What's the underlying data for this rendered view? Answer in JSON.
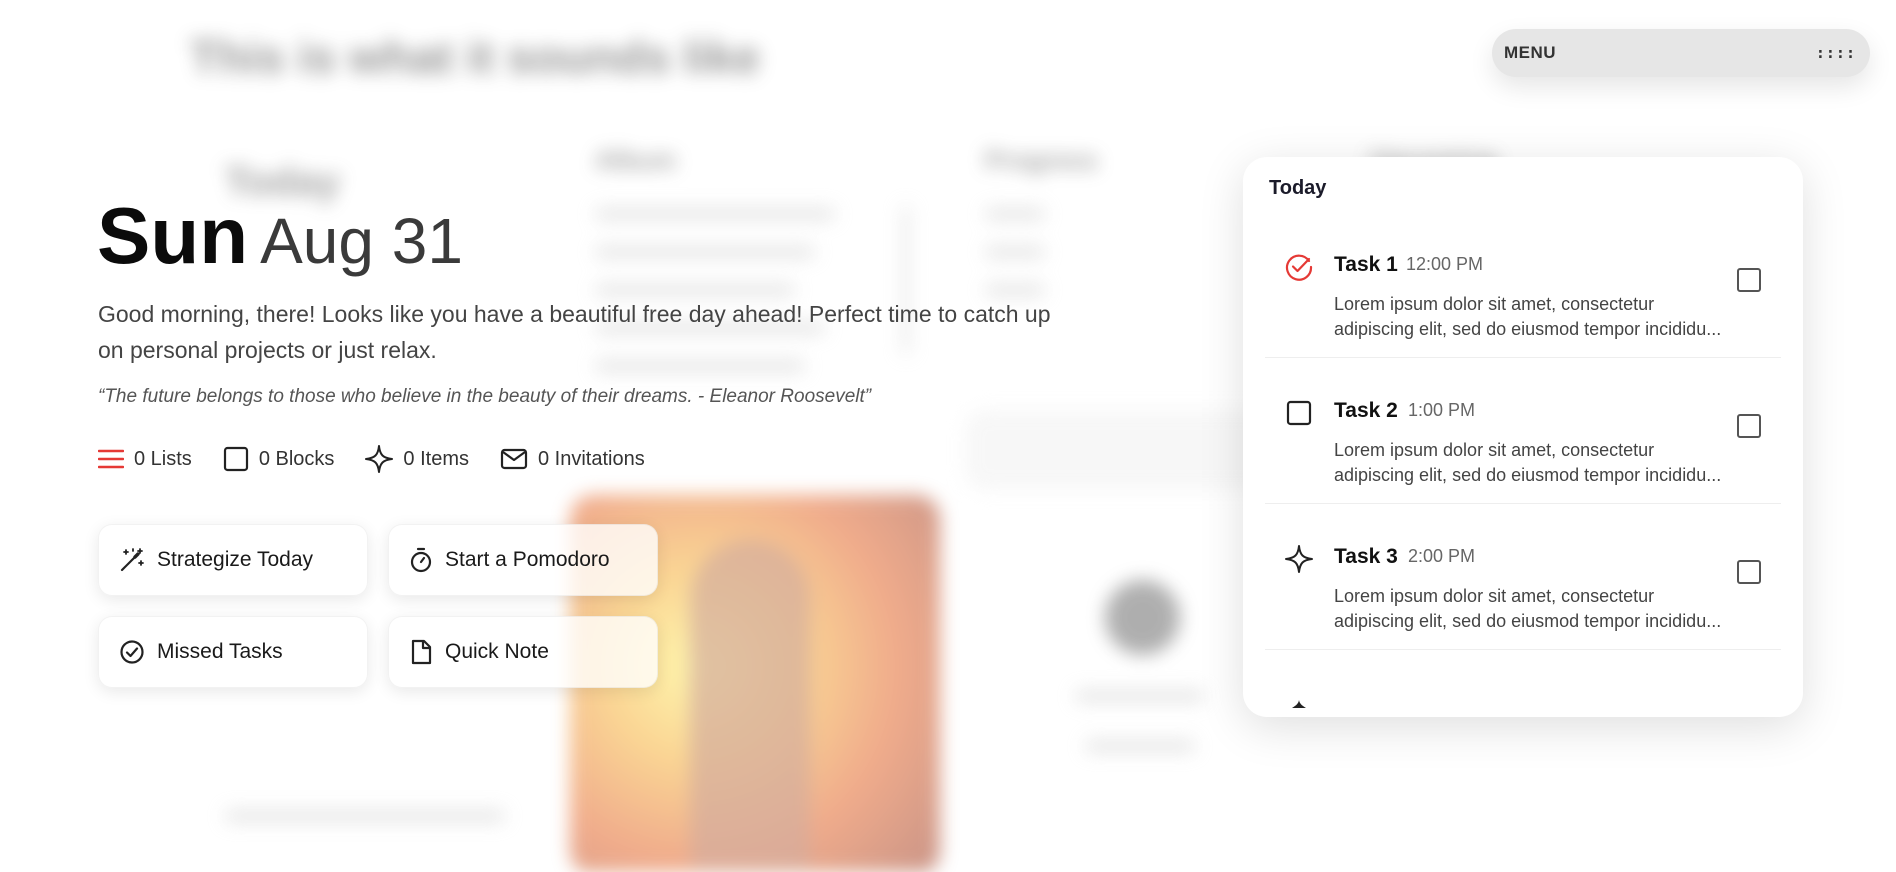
{
  "menu": {
    "label": "MENU",
    "dots": "::::"
  },
  "header": {
    "day": "Sun",
    "date": "Aug 31"
  },
  "greeting": "Good morning, there! Looks like you have a beautiful free day ahead! Perfect time to catch up on personal projects or just relax.",
  "quote": "“The future belongs to those who believe in the beauty of their dreams. - Eleanor Roosevelt”",
  "stats": [
    {
      "icon": "list-icon",
      "label": "0 Lists",
      "color": "#e53935"
    },
    {
      "icon": "square-icon",
      "label": "0 Blocks",
      "color": "#222222"
    },
    {
      "icon": "sparkle-icon",
      "label": "0 Items",
      "color": "#222222"
    },
    {
      "icon": "mail-icon",
      "label": "0 Invitations",
      "color": "#222222"
    }
  ],
  "actions": [
    {
      "icon": "magic-wand-icon",
      "label": "Strategize Today"
    },
    {
      "icon": "timer-icon",
      "label": "Start a Pomodoro"
    },
    {
      "icon": "check-circle-icon",
      "label": "Missed Tasks"
    },
    {
      "icon": "note-icon",
      "label": "Quick Note"
    }
  ],
  "today": {
    "title": "Today",
    "tasks": [
      {
        "icon": "check-circle-icon",
        "icon_color": "#e53935",
        "name": "Task 1",
        "time": "12:00 PM",
        "description": "Lorem ipsum dolor sit amet, consectetur adipiscing elit, sed do eiusmod tempor incididu..."
      },
      {
        "icon": "square-icon",
        "icon_color": "#222222",
        "name": "Task 2",
        "time": "1:00 PM",
        "description": "Lorem ipsum dolor sit amet, consectetur adipiscing elit, sed do eiusmod tempor incididu..."
      },
      {
        "icon": "sparkle-icon",
        "icon_color": "#222222",
        "name": "Task 3",
        "time": "2:00 PM",
        "description": "Lorem ipsum dolor sit amet, consectetur adipiscing elit, sed do eiusmod tempor incididu..."
      }
    ]
  }
}
